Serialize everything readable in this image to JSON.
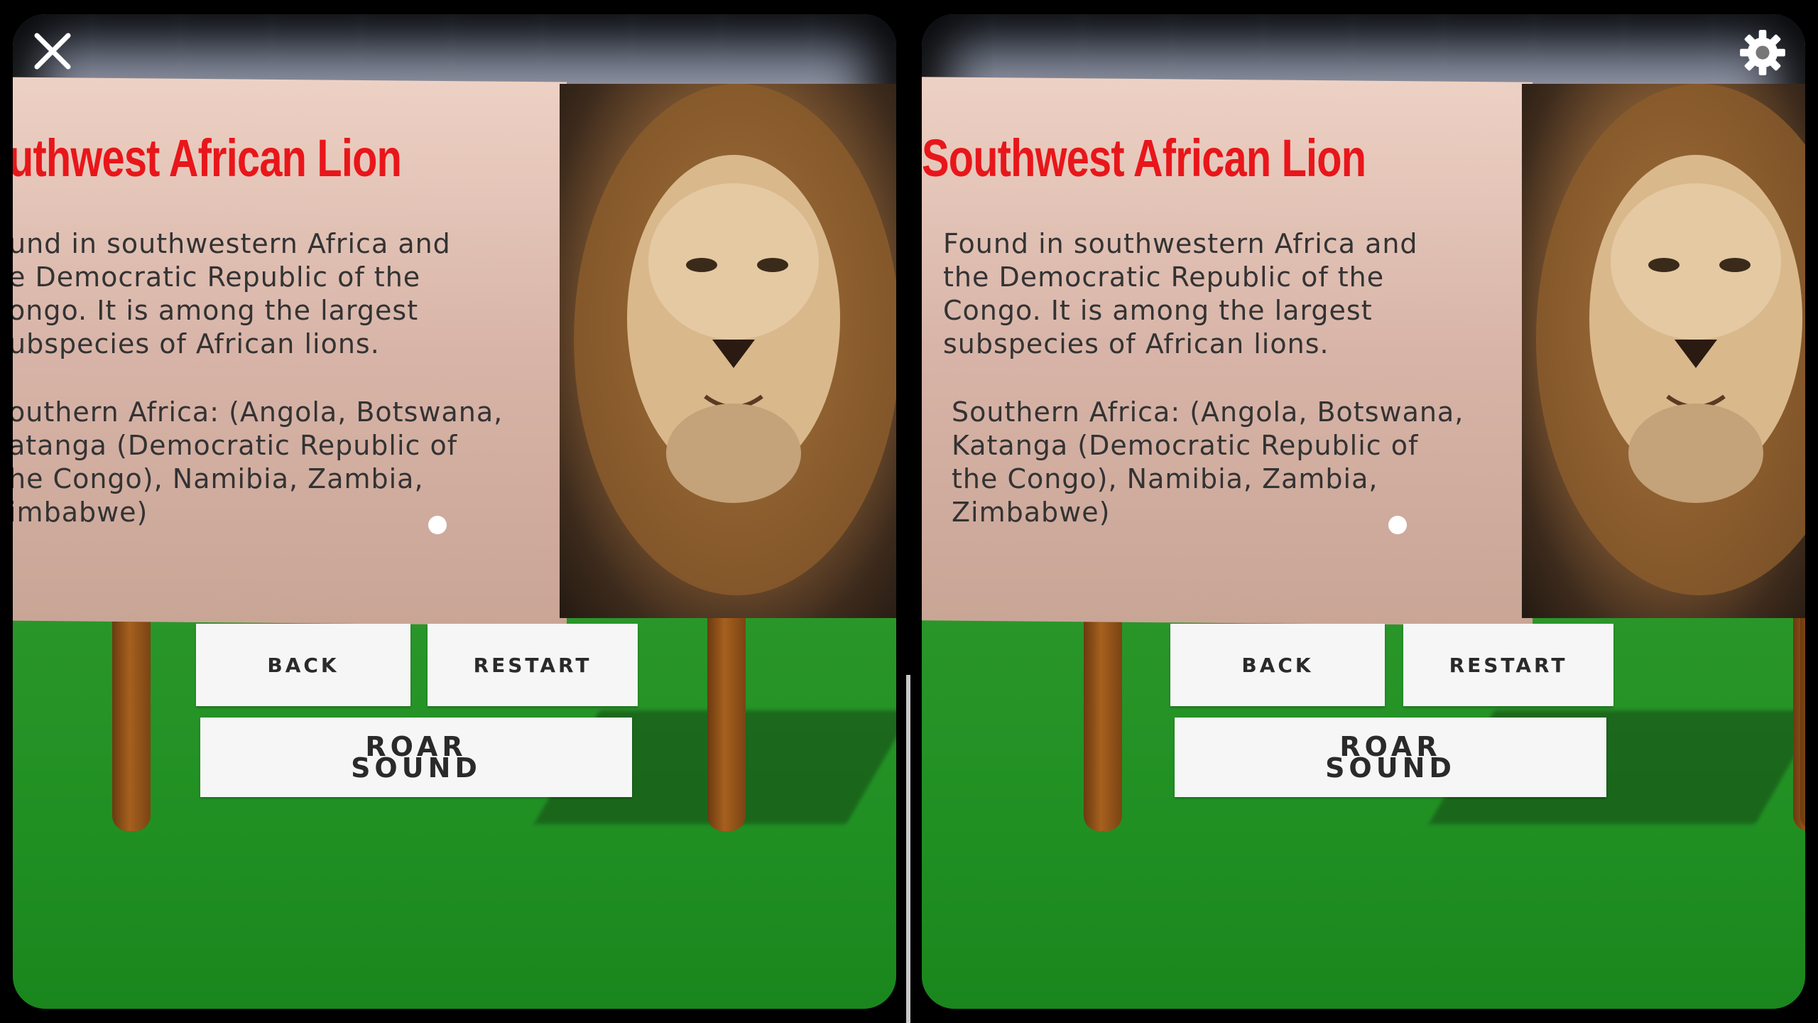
{
  "toolbar": {
    "close_icon": "close-icon",
    "settings_icon": "gear-icon"
  },
  "sign": {
    "title": "Southwest African Lion",
    "left_title": "uthwest African Lion",
    "paragraph1": "Found in southwestern Africa and\nthe Democratic Republic of the\nCongo. It is among the largest\nsubspecies of African lions.",
    "left_paragraph1": "und in southwestern Africa and\ne Democratic Republic of the\nongo. It is among the largest\nubspecies of African lions.",
    "paragraph2": "Southern Africa: (Angola, Botswana,\nKatanga (Democratic Republic of\nthe Congo), Namibia, Zambia,\nZimbabwe)",
    "left_paragraph2": "outhern Africa: (Angola, Botswana,\natanga (Democratic Republic of\nhe Congo), Namibia, Zambia,\nimbabwe)"
  },
  "buttons": {
    "back": "BACK",
    "restart": "RESTART",
    "roar": "ROAR\nSOUND"
  },
  "colors": {
    "title": "#e8161a",
    "ground": "#22972a",
    "sign": "#d8b4a8"
  }
}
